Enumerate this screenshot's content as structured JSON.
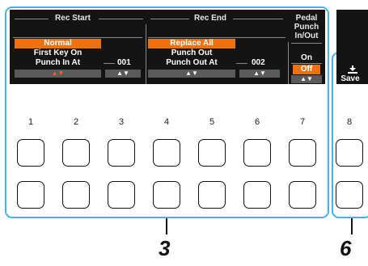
{
  "display": {
    "rec_start": {
      "header": "Rec Start",
      "items": [
        "Normal",
        "First Key On",
        "Punch In At"
      ],
      "selected": "Normal",
      "value": "001"
    },
    "rec_end": {
      "header": "Rec End",
      "items": [
        "Replace All",
        "Punch Out",
        "Punch Out At"
      ],
      "selected": "Replace All",
      "value": "002"
    },
    "pedal": {
      "header_line1": "Pedal",
      "header_line2": "Punch",
      "header_line3": "In/Out",
      "options": [
        "On",
        "Off"
      ],
      "selected": "Off"
    },
    "save": {
      "label": "Save"
    },
    "arrows": "▲▼"
  },
  "buttons": {
    "labels": [
      "1",
      "2",
      "3",
      "4",
      "5",
      "6",
      "7",
      "8"
    ]
  },
  "callouts": [
    "3",
    "6"
  ],
  "colors": {
    "highlight": "#f07010",
    "frame": "#3fb7e6",
    "display_bg": "#141414"
  }
}
